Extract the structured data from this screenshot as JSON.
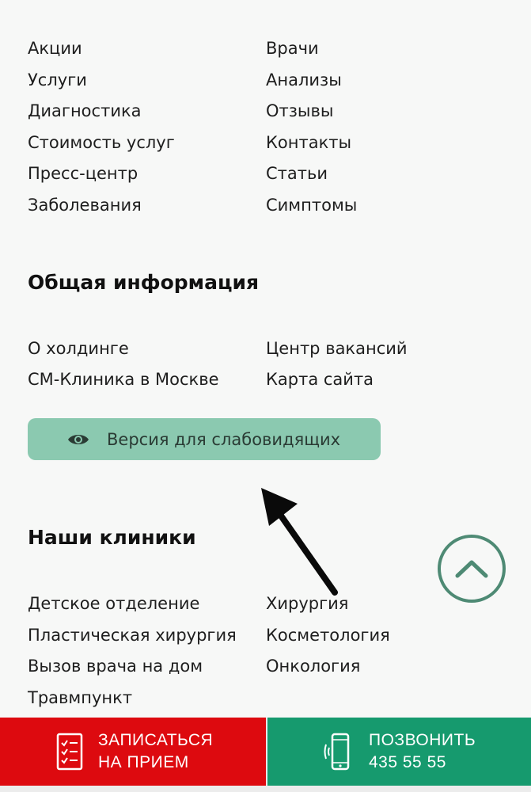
{
  "menu": {
    "left": [
      "Акции",
      "Услуги",
      "Диагностика",
      "Стоимость услуг",
      "Пресс-центр",
      "Заболевания"
    ],
    "right": [
      "Врачи",
      "Анализы",
      "Отзывы",
      "Контакты",
      "Статьи",
      "Симптомы"
    ]
  },
  "general_info": {
    "heading": "Общая информация",
    "left": [
      "О холдинге",
      "СМ-Клиника в Москве"
    ],
    "right": [
      "Центр вакансий",
      "Карта сайта"
    ]
  },
  "accessibility": {
    "label": "Версия для слабовидящих",
    "icon": "eye-icon"
  },
  "clinics": {
    "heading": "Наши клиники",
    "left": [
      "Детское отделение",
      "Пластическая хирургия",
      "Вызов врача на дом",
      "Травмпункт"
    ],
    "right": [
      "Хирургия",
      "Косметология",
      "Онкология"
    ]
  },
  "scroll_top": {
    "icon": "chevron-up-icon"
  },
  "bottom_bar": {
    "book": {
      "line1": "ЗАПИСАТЬСЯ",
      "line2": "НА ПРИЕМ",
      "icon": "checklist-icon",
      "color": "#dd0a0f"
    },
    "call": {
      "line1": "ПОЗВОНИТЬ",
      "line2": "435 55 55",
      "icon": "phone-icon",
      "color": "#169a6e"
    }
  },
  "colors": {
    "background": "#f7f8f7",
    "accessibility_button": "#8bc9b0",
    "scroll_top_ring": "#4e8a74"
  }
}
